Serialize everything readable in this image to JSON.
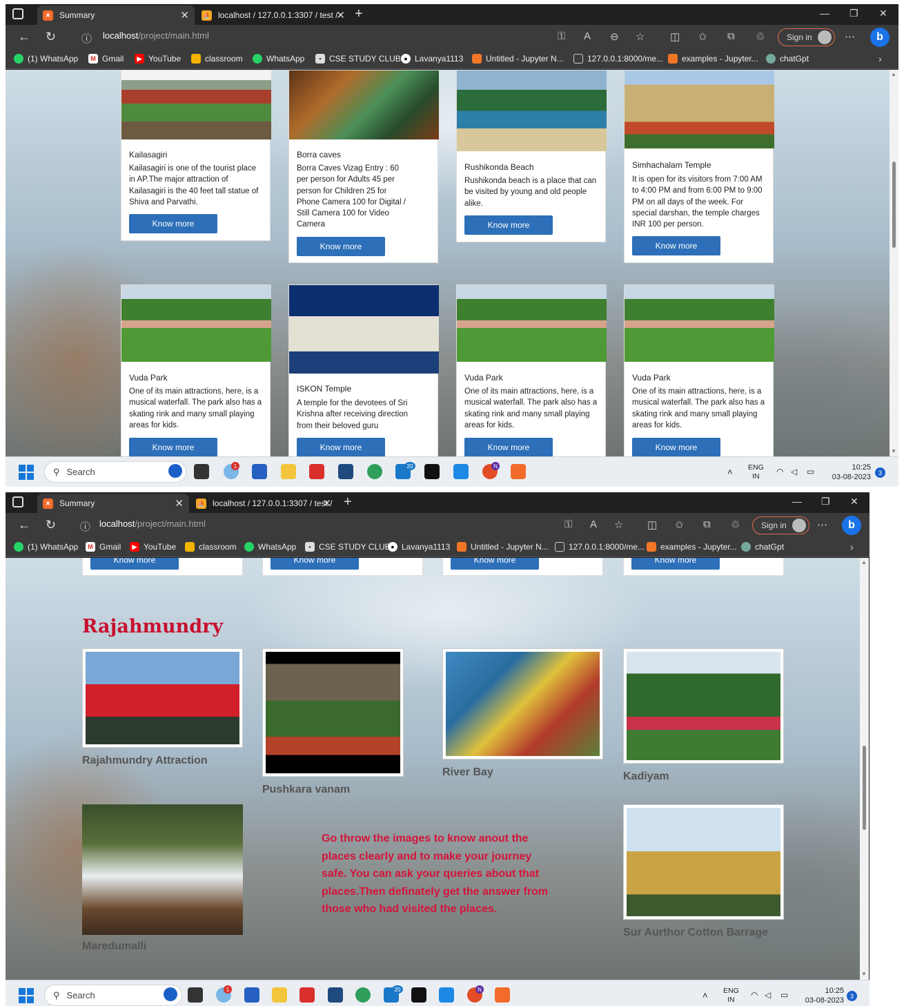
{
  "browser": {
    "tabs": [
      {
        "label": "Summary"
      },
      {
        "label": "localhost / 127.0.0.1:3307 / test /"
      }
    ],
    "url_host": "localhost",
    "url_path": "/project/main.html",
    "sign_in": "Sign in",
    "bookmarks": [
      "(1) WhatsApp",
      "Gmail",
      "YouTube",
      "classroom",
      "WhatsApp",
      "CSE STUDY CLUB",
      "Lavanya1113",
      "Untitled - Jupyter N...",
      "127.0.0.1:8000/me...",
      "examples - Jupyter...",
      "chatGpt"
    ]
  },
  "cards_row1": [
    {
      "title": "Kailasagiri",
      "desc": "Kailasagiri is one of the tourist place in AP.The major attraction of Kailasagiri is the 40 feet tall statue of Shiva and Parvathi.",
      "button": "Know more"
    },
    {
      "title": "Borra caves",
      "desc": "Borra Caves Vizag Entry : 60 per person for Adults 45 per person for Children 25 for Phone Camera 100 for Digital / Still Camera 100 for Video Camera",
      "button": "Know more"
    },
    {
      "title": "Rushikonda Beach",
      "desc": "Rushikonda beach is a place that can be visited by young and old people alike.",
      "button": "Know more"
    },
    {
      "title": "Simhachalam Temple",
      "desc": "It is open for its visitors from 7:00 AM to 4:00 PM and from 6:00 PM to 9:00 PM on all days of the week. For special darshan, the temple charges INR 100 per person.",
      "button": "Know more"
    }
  ],
  "cards_row2": [
    {
      "title": "Vuda Park",
      "desc": "One of its main attractions, here, is a musical waterfall. The park also has a skating rink and many small playing areas for kids.",
      "button": "Know more"
    },
    {
      "title": "ISKON Temple",
      "desc": "A temple for the devotees of Sri Krishna after receiving direction from their beloved guru",
      "button": "Know more"
    },
    {
      "title": "Vuda Park",
      "desc": "One of its main attractions, here, is a musical waterfall. The park also has a skating rink and many small playing areas for kids.",
      "button": "Know more"
    },
    {
      "title": "Vuda Park",
      "desc": "One of its main attractions, here, is a musical waterfall. The park also has a skating rink and many small playing areas for kids.",
      "button": "Know more"
    }
  ],
  "rajahmundry": {
    "title": "Rajahmundry",
    "button_stub": "Know more",
    "photos": [
      {
        "caption": "Rajahmundry Attraction"
      },
      {
        "caption": "Pushkara vanam"
      },
      {
        "caption": "River Bay"
      },
      {
        "caption": "Kadiyam"
      },
      {
        "caption": "Maredumalli"
      },
      {
        "caption": "Sur Aurthor Cotton Barrage"
      }
    ],
    "note": "Go throw the images to know anout the places clearly and to make your journey safe. You can ask your queries about that places.Then definately get the answer from those who had visited the places."
  },
  "taskbar": {
    "search": "Search",
    "lang": "ENG",
    "region": "IN",
    "time": "10:25",
    "date": "03-08-2023",
    "notifications": "3",
    "badge_red": "1",
    "badge_blue": "20",
    "badge_n": "N"
  }
}
